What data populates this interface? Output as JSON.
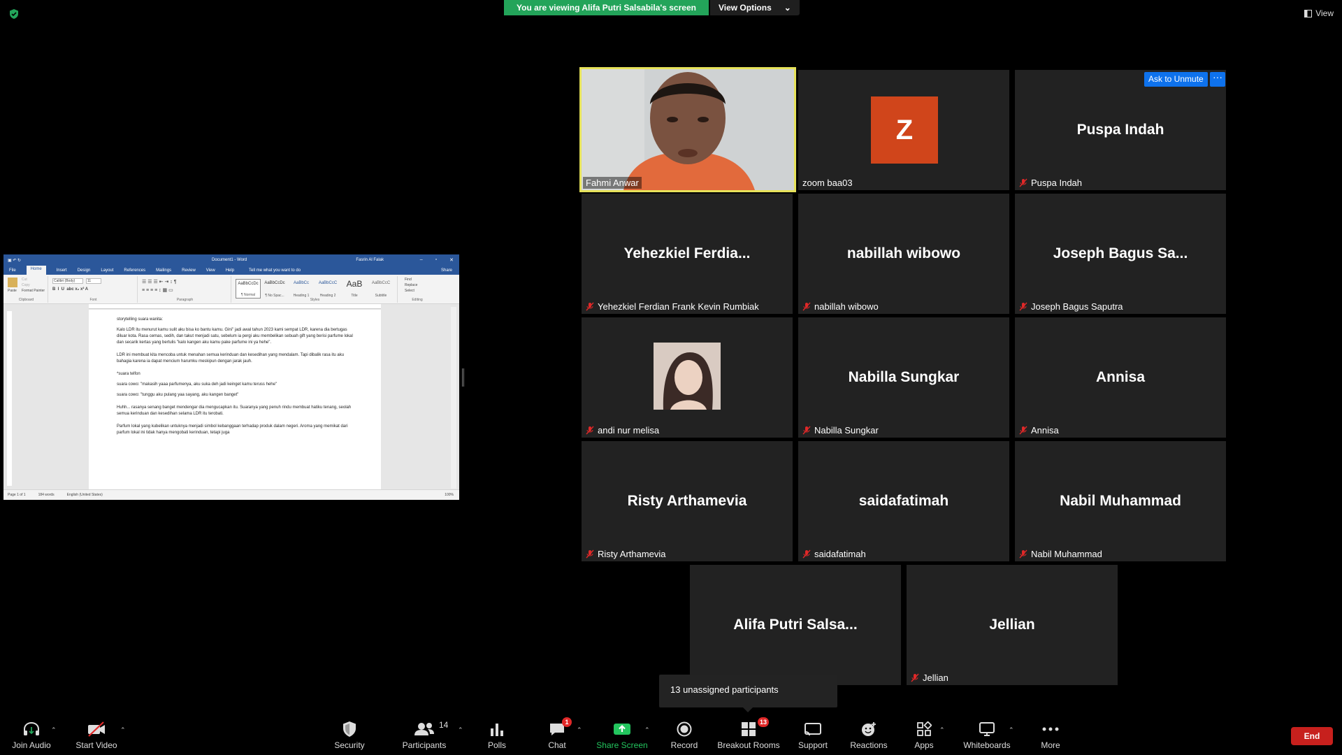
{
  "colors": {
    "accent": "#0e72ed",
    "banner": "#23a45a",
    "end": "#c7201d",
    "tile_bg": "#222222",
    "active_border": "#e6e25a",
    "z_avatar": "#d0451b"
  },
  "top": {
    "banner_text": "You are viewing Alifa Putri Salsabila's screen",
    "view_options": "View Options",
    "view": "View"
  },
  "word": {
    "title": "Document1 - Word",
    "user": "Fasrin Al Falak",
    "tabs": [
      "File",
      "Home",
      "Insert",
      "Design",
      "Layout",
      "References",
      "Mailings",
      "Review",
      "View",
      "Help"
    ],
    "tell_me": "Tell me what you want to do",
    "share": "Share",
    "clipboard": {
      "paste": "Paste",
      "cut": "Cut",
      "copy": "Copy",
      "format_painter": "Format Painter",
      "group": "Clipboard"
    },
    "font": {
      "name": "Calibri (Body)",
      "size": "11",
      "group": "Font"
    },
    "paragraph_group": "Paragraph",
    "styles": [
      {
        "preview": "AaBbCcDc",
        "name": "¶ Normal"
      },
      {
        "preview": "AaBbCcDc",
        "name": "¶ No Spac..."
      },
      {
        "preview": "AaBbCc",
        "name": "Heading 1"
      },
      {
        "preview": "AaBbCcC",
        "name": "Heading 2"
      },
      {
        "preview": "AaB",
        "name": "Title"
      },
      {
        "preview": "AaBbCcC",
        "name": "Subtitle"
      }
    ],
    "styles_group": "Styles",
    "editing": {
      "find": "Find",
      "replace": "Replace",
      "select": "Select",
      "group": "Editing"
    },
    "paragraphs": [
      "storytelling suara wanita:",
      "Kalo LDR itu menurut kamu sulit aku bisa ko bantu kamu. Gini\" jadi awal tahun 2023 kami sempat LDR, karena dia bertugas diluar kota. Rasa cemas, sedih, dan takut menjadi satu, sebelum ia pergi aku membelikan sebuah gift yang berisi parfume lokal dan secarik kertas yang bertulis \"kalo kangen aku kamu pake parfume ini ya hehe\".",
      "LDR ini membuat kita mencoba untuk menahan semua kerinduan dan kesedihan yang mendalam. Tapi dibalik rasa itu aku bahagia karena ia dapat mencium harumku meskipun dengan jarak jauh.",
      "*suara telfon",
      "suara cowo: \"makasih yaaa parfumenya, aku suka deh jadi keinget kamu teruss hehe\"",
      "suara cowo: \"tunggu aku pulang yaa sayang, aku kangen banget\"",
      "Huhh... rasanya senang banget mendengar dia mengucapkan itu. Suaranya yang penuh rindu membuat hatiku tenang, seolah semua kerinduan dan kesedihan selama LDR itu terobati.",
      "Parfum lokal yang kubelikan untuknya menjadi simbol kebanggaan terhadap produk dalam negeri. Aroma yang memikat dari parfum lokal ini tidak hanya mengobati kerinduan, tetapi juga"
    ],
    "status": {
      "page": "Page 1 of 1",
      "words": "184 words",
      "lang": "English (United States)",
      "zoom": "100%"
    }
  },
  "tiles": [
    {
      "id": "fahmi",
      "name": "Fahmi Anwar",
      "type": "video",
      "muted": false,
      "active": true
    },
    {
      "id": "zoom",
      "name": "zoom baa03",
      "type": "avatar-z",
      "avatar_letter": "Z",
      "muted": false
    },
    {
      "id": "puspa",
      "name": "Puspa Indah",
      "big": "Puspa Indah",
      "type": "name",
      "muted": true
    },
    {
      "id": "yehez",
      "name": "Yehezkiel Ferdian Frank Kevin Rumbiak",
      "big": "Yehezkiel  Ferdia...",
      "type": "name",
      "muted": true
    },
    {
      "id": "nabillah",
      "name": "nabillah wibowo",
      "big": "nabillah wibowo",
      "type": "name",
      "muted": true
    },
    {
      "id": "joseph",
      "name": "Joseph Bagus Saputra",
      "big": "Joseph Bagus Sa...",
      "type": "name",
      "muted": true
    },
    {
      "id": "andi",
      "name": "andi nur melisa",
      "type": "photo",
      "muted": true
    },
    {
      "id": "nabilla",
      "name": "Nabilla Sungkar",
      "big": "Nabilla Sungkar",
      "type": "name",
      "muted": true
    },
    {
      "id": "annisa",
      "name": "Annisa",
      "big": "Annisa",
      "type": "name",
      "muted": true
    },
    {
      "id": "risty",
      "name": "Risty Arthamevia",
      "big": "Risty Arthamevia",
      "type": "name",
      "muted": true
    },
    {
      "id": "saida",
      "name": "saidafatimah",
      "big": "saidafatimah",
      "type": "name",
      "muted": true
    },
    {
      "id": "nabil",
      "name": "Nabil Muhammad",
      "big": "Nabil Muhammad",
      "type": "name",
      "muted": true
    },
    {
      "id": "alifa",
      "name": "",
      "big": "Alifa  Putri  Salsa...",
      "type": "name",
      "muted": false
    },
    {
      "id": "jellian",
      "name": "Jellian",
      "big": "Jellian",
      "type": "name",
      "muted": true
    }
  ],
  "ask_to_unmute": "Ask to Unmute",
  "more_dots": "···",
  "tooltip": "13 unassigned participants",
  "toolbar": {
    "join_audio": "Join Audio",
    "start_video": "Start Video",
    "security": "Security",
    "participants": "Participants",
    "participants_count": "14",
    "polls": "Polls",
    "chat": "Chat",
    "chat_badge": "1",
    "share_screen": "Share Screen",
    "record": "Record",
    "breakout_rooms": "Breakout Rooms",
    "breakout_badge": "13",
    "support": "Support",
    "reactions": "Reactions",
    "apps": "Apps",
    "whiteboards": "Whiteboards",
    "more": "More",
    "end": "End"
  }
}
